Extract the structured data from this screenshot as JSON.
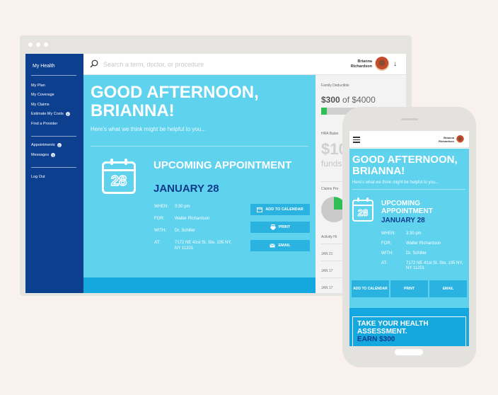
{
  "sidebar": {
    "title": "My Health",
    "items": [
      {
        "label": "My Plan"
      },
      {
        "label": "My Coverage"
      },
      {
        "label": "My Claims"
      },
      {
        "label": "Estimate My Costs",
        "badge": "1"
      },
      {
        "label": "Find a Provider"
      }
    ],
    "secondary": [
      {
        "label": "Appointments",
        "badge": "1"
      },
      {
        "label": "Messages",
        "badge": "1"
      }
    ],
    "logout": "Log Out"
  },
  "search": {
    "placeholder": "Search a term, doctor, or procedure"
  },
  "user": {
    "first": "Brianna",
    "last": "Richardson"
  },
  "hero": {
    "greeting": "GOOD AFTERNOON, BRIANNA!",
    "subtitle": "Here's what we think might be helpful to you..."
  },
  "appointment": {
    "calendar_day": "28",
    "title": "UPCOMING APPOINTMENT",
    "date": "JANUARY 28",
    "details": [
      {
        "label": "WHEN:",
        "value": "3:30 pm"
      },
      {
        "label": "FOR:",
        "value": "Walter Richardson"
      },
      {
        "label": "WITH:",
        "value": "Dr. Schiller"
      },
      {
        "label": "AT:",
        "value": "7172 NE 41st St. Ste. 105 NY, NY 11201"
      }
    ],
    "buttons": {
      "calendar": "ADD TO CALENDAR",
      "print": "PRINT",
      "email": "EMAIL"
    }
  },
  "right_panel": {
    "deductible_label": "Family Deductible",
    "deductible_spent": "$300",
    "deductible_of": "of $4000",
    "deductible_progress": 0.075,
    "hra_label": "HRA Balan",
    "hra_value": "$10",
    "hra_sub": "funds",
    "claims_label": "Claims Pro",
    "claims_fraction": 0.25,
    "activity_label": "Activity Hi",
    "activity_dates": [
      "JAN 21",
      "JAN 17",
      "JAN 17"
    ]
  },
  "phone": {
    "user": {
      "first": "Brianna",
      "last": "Richardson"
    },
    "buttons": {
      "calendar": "ADD TO CALENDAR",
      "print": "PRINT",
      "email": "EMAIL"
    },
    "promo": {
      "title": "TAKE YOUR HEALTH ASSESSMENT.",
      "earn": "EARN $300"
    }
  },
  "colors": {
    "sidebar": "#0d3f8f",
    "hero": "#5fd2ee",
    "button": "#2ab3e0",
    "accent_dark": "#0f3b8a",
    "progress": "#2fbf56"
  },
  "icons": [
    "search-icon",
    "calendar-icon",
    "printer-icon",
    "email-icon",
    "hamburger-icon",
    "chevron-down-icon"
  ]
}
